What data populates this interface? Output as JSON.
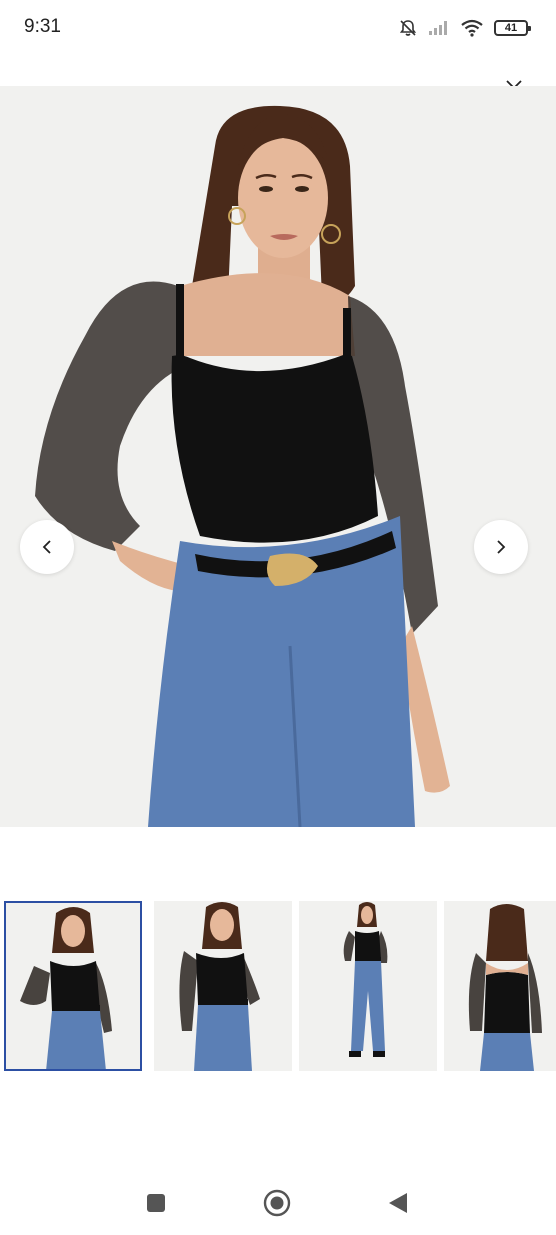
{
  "status_bar": {
    "time": "9:31",
    "battery_level": "41",
    "icons": [
      "mute-bell-icon",
      "signal-icon",
      "wifi-icon",
      "battery-icon"
    ]
  },
  "viewer": {
    "close_icon": "close-icon",
    "prev_icon": "chevron-left-icon",
    "next_icon": "chevron-right-icon",
    "image_count": 4,
    "selected_index": 0
  },
  "thumbnails": [
    {
      "view": "front-close",
      "selected": true
    },
    {
      "view": "front-hand-in-pocket",
      "selected": false
    },
    {
      "view": "full-body",
      "selected": false
    },
    {
      "view": "back",
      "selected": false
    }
  ],
  "nav_bar": {
    "icons": [
      "recents-square-icon",
      "home-circle-icon",
      "back-triangle-icon"
    ]
  },
  "colors": {
    "accent_selected": "#2c4fa3",
    "photo_background": "#f1f1ef",
    "top_black": "#111111",
    "denim_blue": "#5b7fb5",
    "skin": "#e2b394",
    "hair": "#4a2a1a"
  }
}
